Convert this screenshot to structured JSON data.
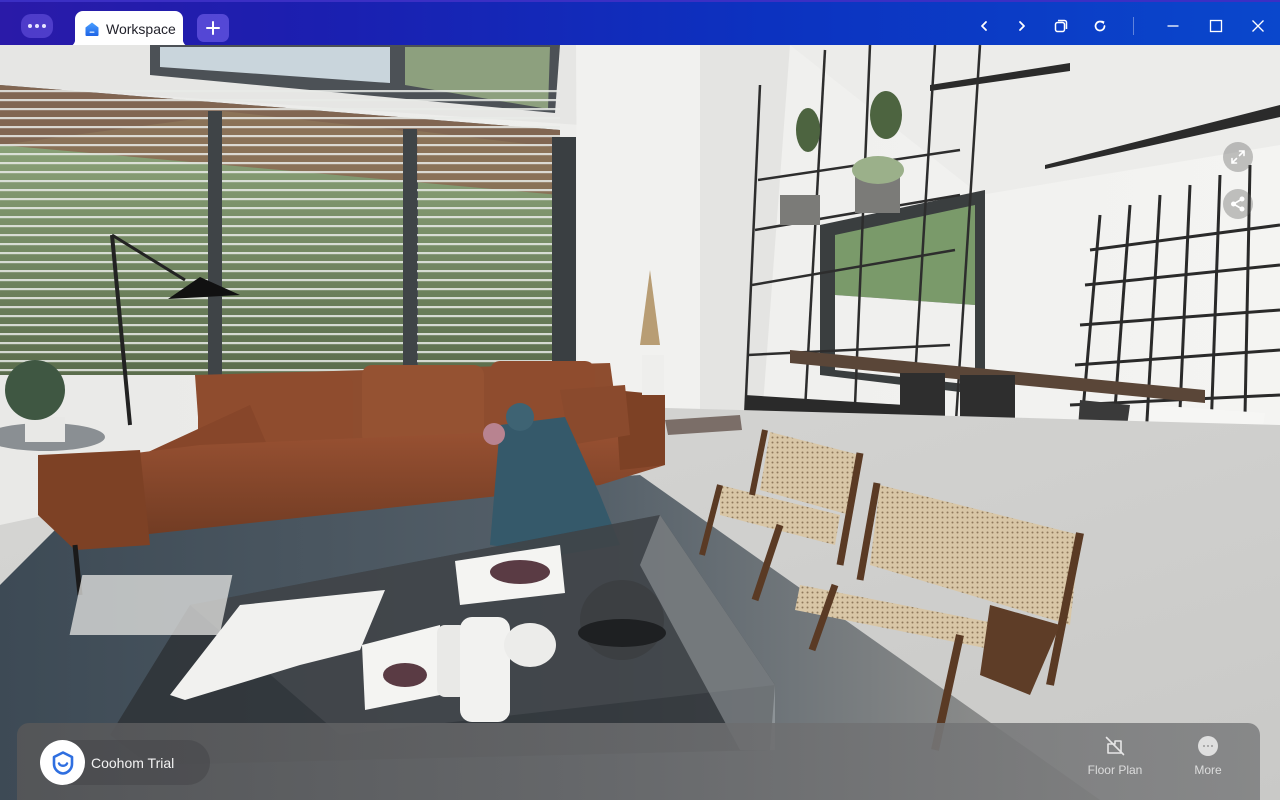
{
  "window": {
    "tab": {
      "label": "Workspace",
      "icon": "home-icon"
    },
    "controls": {
      "menu": "more-horizontal-icon",
      "new_tab": "plus-icon",
      "back": "chevron-left-icon",
      "forward": "chevron-right-icon",
      "duplicate": "copy-window-icon",
      "reload": "reload-icon",
      "minimize": "minimize-icon",
      "maximize": "maximize-icon",
      "close": "close-icon"
    },
    "colors": {
      "titlebar_start": "#2a1aa8",
      "titlebar_end": "#0a47cc",
      "accent": "#2f6fe0"
    }
  },
  "viewer": {
    "scene_description": "3D panorama render of a living room with leather sofa, glass coffee table, cane chairs and dining area",
    "overlay_buttons": [
      {
        "name": "fullscreen",
        "icon": "expand-arrows-icon"
      },
      {
        "name": "share",
        "icon": "share-icon"
      }
    ]
  },
  "bottom_bar": {
    "brand": {
      "name": "Coohom Trial",
      "icon": "coohom-logo-icon"
    },
    "actions": [
      {
        "label": "Floor Plan",
        "icon": "floor-plan-off-icon"
      },
      {
        "label": "More",
        "icon": "more-circle-icon"
      }
    ]
  }
}
